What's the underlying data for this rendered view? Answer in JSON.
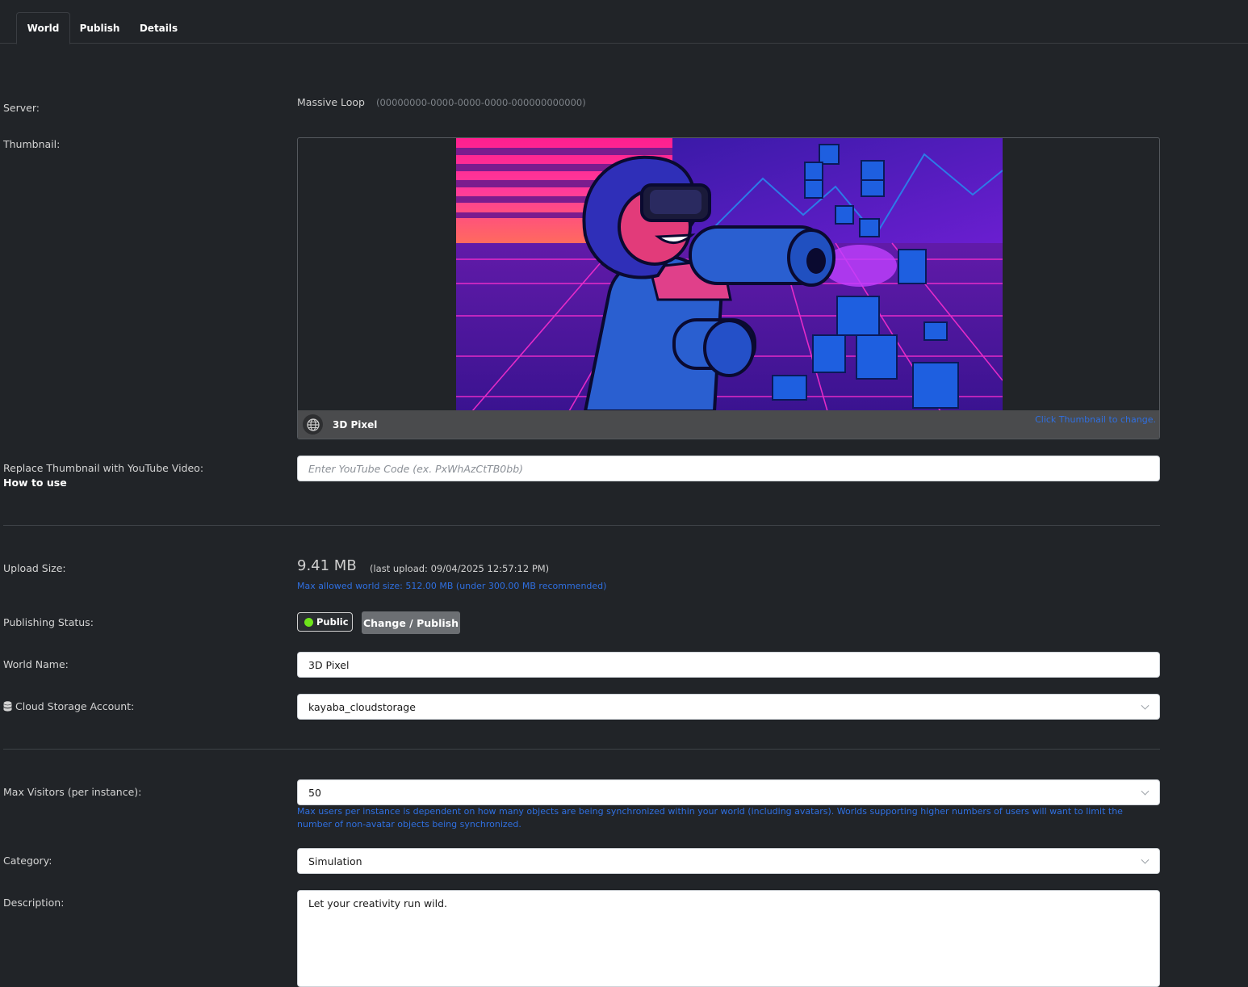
{
  "tabs": [
    {
      "label": "World",
      "active": true
    },
    {
      "label": "Publish",
      "active": false
    },
    {
      "label": "Details",
      "active": false
    }
  ],
  "server": {
    "label": "Server:",
    "name": "Massive Loop",
    "id": "(00000000-0000-0000-0000-000000000000)"
  },
  "thumbnail": {
    "label": "Thumbnail:",
    "world_title": "3D Pixel",
    "hint": "Click Thumbnail to change.",
    "globe_icon": "globe-icon"
  },
  "youtube": {
    "label": "Replace Thumbnail with YouTube Video:",
    "link": "How to use",
    "placeholder": "Enter YouTube Code (ex. PxWhAzCtTB0bb)"
  },
  "upload": {
    "label": "Upload Size:",
    "size": "9.41 MB",
    "last": "(last upload: 09/04/2025 12:57:12 PM)",
    "limit": "Max allowed world size: 512.00 MB (under 300.00 MB recommended)"
  },
  "publishing": {
    "label": "Publishing Status:",
    "status": "Public",
    "status_color": "#6ee41a",
    "button": "Change / Publish"
  },
  "world_name": {
    "label": "World Name:",
    "value": "3D Pixel"
  },
  "cloud": {
    "label": "Cloud Storage Account:",
    "value": "kayaba_cloudstorage",
    "icon": "database-icon"
  },
  "visitors": {
    "label": "Max Visitors (per instance):",
    "value": "50",
    "help": "Max users per instance is dependent on how many objects are being synchronized within your world (including avatars). Worlds supporting higher numbers of users will want to limit the number of non-avatar objects being synchronized."
  },
  "category": {
    "label": "Category:",
    "value": "Simulation"
  },
  "description": {
    "label": "Description:",
    "value": "Let your creativity run wild."
  },
  "colors": {
    "accent_link": "#2f6fe0",
    "background": "#212428"
  }
}
